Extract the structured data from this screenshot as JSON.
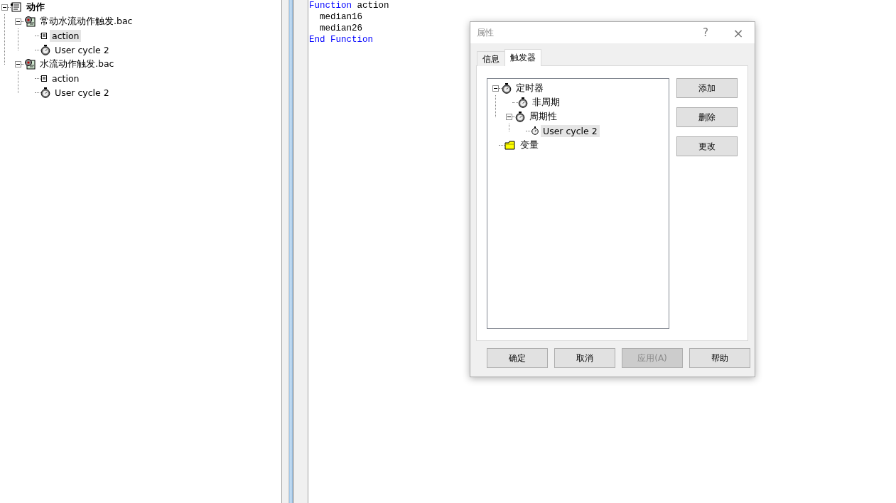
{
  "left_tree": {
    "items": [
      {
        "label": "动作",
        "kind": "script",
        "bold": true,
        "expanded": true,
        "selected": false,
        "children": [
          {
            "label": "常动水流动作触发.bac",
            "kind": "gear",
            "bold": false,
            "expanded": true,
            "selected": false,
            "children": [
              {
                "label": "action",
                "kind": "action",
                "bold": false,
                "selected": true
              },
              {
                "label": "User cycle 2",
                "kind": "timer",
                "bold": false,
                "selected": false
              }
            ]
          },
          {
            "label": "水流动作触发.bac",
            "kind": "gear",
            "bold": false,
            "expanded": true,
            "selected": false,
            "children": [
              {
                "label": "action",
                "kind": "action",
                "bold": false,
                "selected": false
              },
              {
                "label": "User cycle 2",
                "kind": "timer",
                "bold": false,
                "selected": false
              }
            ]
          }
        ]
      }
    ]
  },
  "editor": {
    "lines": [
      [
        {
          "text": "Function",
          "kind": "keyword"
        },
        {
          "text": " action",
          "kind": "plain"
        }
      ],
      [
        {
          "text": "  median16",
          "kind": "plain"
        }
      ],
      [
        {
          "text": "  median26",
          "kind": "plain"
        }
      ],
      [
        {
          "text": "End Function",
          "kind": "keyword"
        }
      ]
    ]
  },
  "dialog": {
    "title": "属性",
    "help": "?",
    "close": "×",
    "tabs": [
      {
        "label": "信息",
        "selected": false
      },
      {
        "label": "触发器",
        "selected": true
      }
    ],
    "tree": [
      {
        "label": "定时器",
        "kind": "timer",
        "expanded": true,
        "selected": false,
        "children": [
          {
            "label": "非周期",
            "kind": "timer",
            "selected": false
          },
          {
            "label": "周期性",
            "kind": "timer",
            "expanded": true,
            "selected": false,
            "children": [
              {
                "label": "User cycle 2",
                "kind": "small-timer",
                "selected": true
              }
            ]
          }
        ]
      },
      {
        "label": "变量",
        "kind": "folder",
        "selected": false
      }
    ],
    "side_buttons": [
      {
        "label": "添加",
        "disabled": false
      },
      {
        "label": "删除",
        "disabled": false
      },
      {
        "label": "更改",
        "disabled": false
      }
    ],
    "buttons": [
      {
        "label": "确定",
        "disabled": false
      },
      {
        "label": "取消",
        "disabled": false
      },
      {
        "label": "应用(A)",
        "disabled": true
      },
      {
        "label": "帮助",
        "disabled": false
      }
    ]
  }
}
